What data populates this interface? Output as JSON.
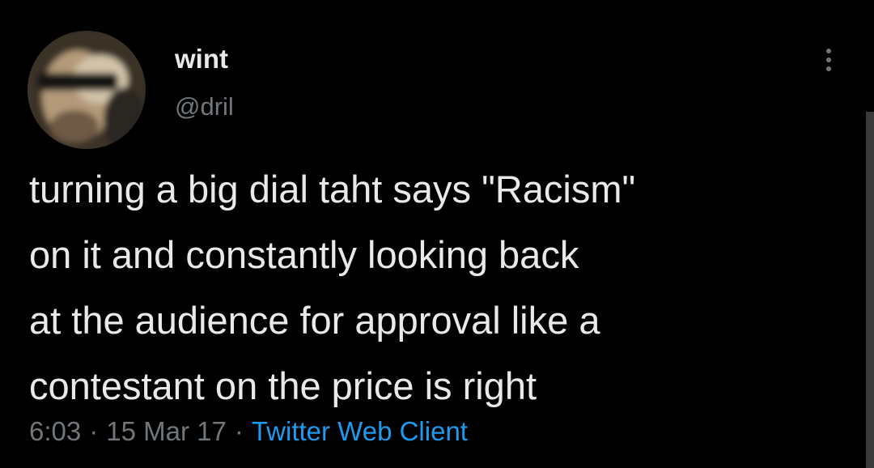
{
  "tweet": {
    "author": {
      "display_name": "wint",
      "handle": "@dril",
      "avatar_icon": "avatar-photo"
    },
    "text": "turning a big dial taht says \"Racism\"\non it and constantly looking back\nat the audience for approval like a\ncontestant on the price is right",
    "time": "6:03",
    "date": "15 Mar 17",
    "separator": "·",
    "source": "Twitter Web Client",
    "more_icon": "more-vertical-icon"
  },
  "colors": {
    "background": "#000000",
    "text_primary": "#e7e9ea",
    "text_secondary": "#71767b",
    "link": "#1d9bf0"
  }
}
